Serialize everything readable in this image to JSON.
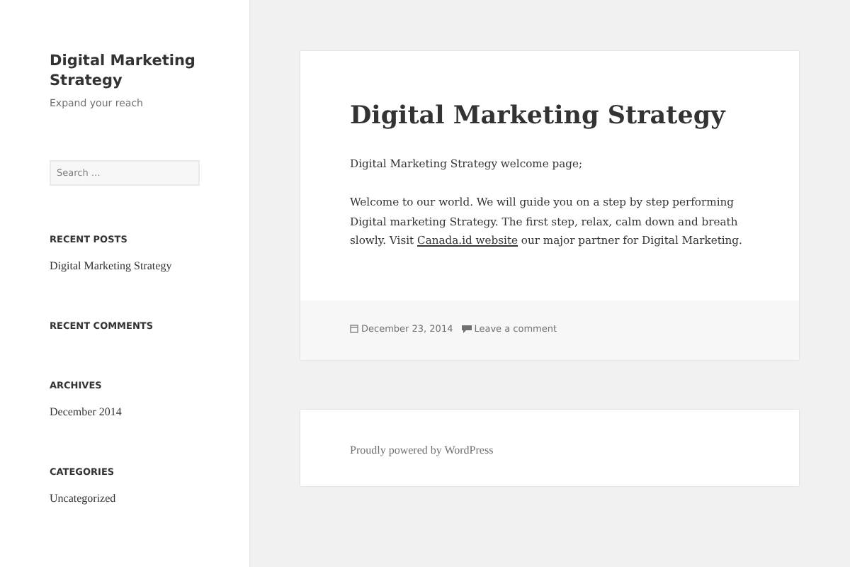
{
  "site": {
    "title": "Digital Marketing Strategy",
    "tagline": "Expand your reach"
  },
  "search": {
    "placeholder": "Search …"
  },
  "widgets": [
    {
      "heading": "RECENT POSTS",
      "items": [
        "Digital Marketing Strategy"
      ]
    },
    {
      "heading": "RECENT COMMENTS"
    },
    {
      "heading": "ARCHIVES",
      "items": [
        "December 2014"
      ]
    },
    {
      "heading": "CATEGORIES",
      "items": [
        "Uncategorized"
      ]
    }
  ],
  "post": {
    "title": "Digital Marketing Strategy",
    "intro": "Digital Marketing Strategy welcome page;",
    "body_before": "Welcome to our world. We will guide you on a step by step performing Digital marketing Strategy. The first step, relax, calm down and breath slowly. Visit ",
    "link": "Canada.id website",
    "body_after": " our major partner for Digital Marketing.",
    "date": "December 23, 2014",
    "comment_link": "Leave a comment"
  },
  "footer": {
    "credit": "Proudly powered by WordPress"
  }
}
